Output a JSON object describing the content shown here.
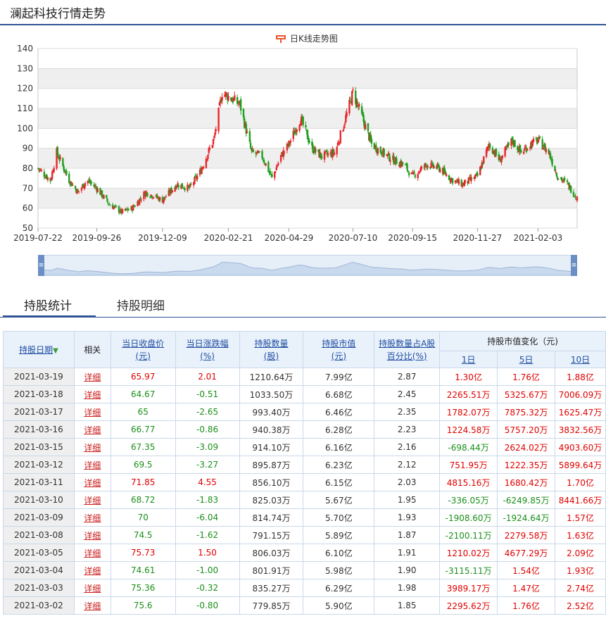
{
  "page_title": "澜起科技行情走势",
  "chart_data": {
    "type": "candlestick",
    "legend": "日K线走势图",
    "ylim": [
      50,
      140
    ],
    "yticks": [
      50,
      60,
      70,
      80,
      90,
      100,
      110,
      120,
      130,
      140
    ],
    "xtick_labels": [
      "2019-07-22",
      "2019-09-26",
      "2019-12-09",
      "2020-02-21",
      "2020-04-29",
      "2020-07-10",
      "2020-09-15",
      "2020-11-27",
      "2021-02-03"
    ],
    "close_path": [
      [
        "2019-07-22",
        80
      ],
      [
        "2019-08-05",
        74
      ],
      [
        "2019-08-12",
        88
      ],
      [
        "2019-08-26",
        74
      ],
      [
        "2019-09-05",
        68
      ],
      [
        "2019-09-15",
        74
      ],
      [
        "2019-09-26",
        70
      ],
      [
        "2019-10-10",
        62
      ],
      [
        "2019-10-24",
        58
      ],
      [
        "2019-11-05",
        60
      ],
      [
        "2019-11-20",
        68
      ],
      [
        "2019-12-09",
        64
      ],
      [
        "2019-12-25",
        72
      ],
      [
        "2020-01-08",
        70
      ],
      [
        "2020-01-20",
        78
      ],
      [
        "2020-02-05",
        95
      ],
      [
        "2020-02-14",
        118
      ],
      [
        "2020-02-21",
        116
      ],
      [
        "2020-03-05",
        112
      ],
      [
        "2020-03-18",
        88
      ],
      [
        "2020-03-30",
        86
      ],
      [
        "2020-04-10",
        75
      ],
      [
        "2020-04-20",
        86
      ],
      [
        "2020-04-29",
        92
      ],
      [
        "2020-05-12",
        105
      ],
      [
        "2020-05-25",
        90
      ],
      [
        "2020-06-05",
        86
      ],
      [
        "2020-06-20",
        88
      ],
      [
        "2020-07-01",
        104
      ],
      [
        "2020-07-10",
        118
      ],
      [
        "2020-07-20",
        106
      ],
      [
        "2020-07-31",
        92
      ],
      [
        "2020-08-12",
        88
      ],
      [
        "2020-08-25",
        84
      ],
      [
        "2020-09-05",
        82
      ],
      [
        "2020-09-15",
        76
      ],
      [
        "2020-10-01",
        82
      ],
      [
        "2020-10-15",
        80
      ],
      [
        "2020-10-30",
        74
      ],
      [
        "2020-11-10",
        72
      ],
      [
        "2020-11-27",
        76
      ],
      [
        "2020-12-10",
        92
      ],
      [
        "2020-12-22",
        84
      ],
      [
        "2021-01-05",
        94
      ],
      [
        "2021-01-15",
        88
      ],
      [
        "2021-01-25",
        92
      ],
      [
        "2021-02-03",
        94
      ],
      [
        "2021-02-15",
        88
      ],
      [
        "2021-02-25",
        76
      ],
      [
        "2021-03-08",
        72
      ],
      [
        "2021-03-19",
        65
      ]
    ]
  },
  "tabs": [
    "持股统计",
    "持股明细"
  ],
  "table": {
    "headers": {
      "date": "持股日期",
      "related": "相关",
      "close_price": [
        "当日收盘价",
        "(元)"
      ],
      "change": [
        "当日涨跌幅",
        "(%)"
      ],
      "shares": [
        "持股数量",
        "(股)"
      ],
      "market_value": [
        "持股市值",
        "(元)"
      ],
      "ratio": [
        "持股数量占A股",
        "百分比(%)"
      ],
      "mv_change": "持股市值变化（元)",
      "mv_change_sub": [
        "1日",
        "5日",
        "10日"
      ]
    },
    "rows": [
      {
        "date": "2021-03-19",
        "link": "详细",
        "close": "65.97",
        "chg": "2.01",
        "shares": "1210.64万",
        "mv": "7.99亿",
        "ratio": "2.87",
        "d1": "1.30亿",
        "d5": "1.76亿",
        "d10": "1.88亿",
        "close_c": "red",
        "chg_c": "red",
        "d1_c": "red",
        "d5_c": "red",
        "d10_c": "red"
      },
      {
        "date": "2021-03-18",
        "link": "详细",
        "close": "64.67",
        "chg": "-0.51",
        "shares": "1033.50万",
        "mv": "6.68亿",
        "ratio": "2.45",
        "d1": "2265.51万",
        "d5": "5325.67万",
        "d10": "7006.09万",
        "close_c": "green",
        "chg_c": "green",
        "d1_c": "red",
        "d5_c": "red",
        "d10_c": "red"
      },
      {
        "date": "2021-03-17",
        "link": "详细",
        "close": "65",
        "chg": "-2.65",
        "shares": "993.40万",
        "mv": "6.46亿",
        "ratio": "2.35",
        "d1": "1782.07万",
        "d5": "7875.32万",
        "d10": "1625.47万",
        "close_c": "green",
        "chg_c": "green",
        "d1_c": "red",
        "d5_c": "red",
        "d10_c": "red"
      },
      {
        "date": "2021-03-16",
        "link": "详细",
        "close": "66.77",
        "chg": "-0.86",
        "shares": "940.38万",
        "mv": "6.28亿",
        "ratio": "2.23",
        "d1": "1224.58万",
        "d5": "5757.20万",
        "d10": "3832.56万",
        "close_c": "green",
        "chg_c": "green",
        "d1_c": "red",
        "d5_c": "red",
        "d10_c": "red"
      },
      {
        "date": "2021-03-15",
        "link": "详细",
        "close": "67.35",
        "chg": "-3.09",
        "shares": "914.10万",
        "mv": "6.16亿",
        "ratio": "2.16",
        "d1": "-698.44万",
        "d5": "2624.02万",
        "d10": "4903.60万",
        "close_c": "green",
        "chg_c": "green",
        "d1_c": "green",
        "d5_c": "red",
        "d10_c": "red"
      },
      {
        "date": "2021-03-12",
        "link": "详细",
        "close": "69.5",
        "chg": "-3.27",
        "shares": "895.87万",
        "mv": "6.23亿",
        "ratio": "2.12",
        "d1": "751.95万",
        "d5": "1222.35万",
        "d10": "5899.64万",
        "close_c": "green",
        "chg_c": "green",
        "d1_c": "red",
        "d5_c": "red",
        "d10_c": "red"
      },
      {
        "date": "2021-03-11",
        "link": "详细",
        "close": "71.85",
        "chg": "4.55",
        "shares": "856.10万",
        "mv": "6.15亿",
        "ratio": "2.03",
        "d1": "4815.16万",
        "d5": "1680.42万",
        "d10": "1.70亿",
        "close_c": "red",
        "chg_c": "red",
        "d1_c": "red",
        "d5_c": "red",
        "d10_c": "red"
      },
      {
        "date": "2021-03-10",
        "link": "详细",
        "close": "68.72",
        "chg": "-1.83",
        "shares": "825.03万",
        "mv": "5.67亿",
        "ratio": "1.95",
        "d1": "-336.05万",
        "d5": "-6249.85万",
        "d10": "8441.66万",
        "close_c": "green",
        "chg_c": "green",
        "d1_c": "green",
        "d5_c": "green",
        "d10_c": "red"
      },
      {
        "date": "2021-03-09",
        "link": "详细",
        "close": "70",
        "chg": "-6.04",
        "shares": "814.74万",
        "mv": "5.70亿",
        "ratio": "1.93",
        "d1": "-1908.60万",
        "d5": "-1924.64万",
        "d10": "1.57亿",
        "close_c": "green",
        "chg_c": "green",
        "d1_c": "green",
        "d5_c": "green",
        "d10_c": "red"
      },
      {
        "date": "2021-03-08",
        "link": "详细",
        "close": "74.5",
        "chg": "-1.62",
        "shares": "791.15万",
        "mv": "5.89亿",
        "ratio": "1.87",
        "d1": "-2100.11万",
        "d5": "2279.58万",
        "d10": "1.63亿",
        "close_c": "green",
        "chg_c": "green",
        "d1_c": "green",
        "d5_c": "red",
        "d10_c": "red"
      },
      {
        "date": "2021-03-05",
        "link": "详细",
        "close": "75.73",
        "chg": "1.50",
        "shares": "806.03万",
        "mv": "6.10亿",
        "ratio": "1.91",
        "d1": "1210.02万",
        "d5": "4677.29万",
        "d10": "2.09亿",
        "close_c": "red",
        "chg_c": "red",
        "d1_c": "red",
        "d5_c": "red",
        "d10_c": "red"
      },
      {
        "date": "2021-03-04",
        "link": "详细",
        "close": "74.61",
        "chg": "-1.00",
        "shares": "801.91万",
        "mv": "5.98亿",
        "ratio": "1.90",
        "d1": "-3115.11万",
        "d5": "1.54亿",
        "d10": "1.93亿",
        "close_c": "green",
        "chg_c": "green",
        "d1_c": "green",
        "d5_c": "red",
        "d10_c": "red"
      },
      {
        "date": "2021-03-03",
        "link": "详细",
        "close": "75.36",
        "chg": "-0.32",
        "shares": "835.27万",
        "mv": "6.29亿",
        "ratio": "1.98",
        "d1": "3989.17万",
        "d5": "1.47亿",
        "d10": "2.74亿",
        "close_c": "green",
        "chg_c": "green",
        "d1_c": "red",
        "d5_c": "red",
        "d10_c": "red"
      },
      {
        "date": "2021-03-02",
        "link": "详细",
        "close": "75.6",
        "chg": "-0.80",
        "shares": "779.85万",
        "mv": "5.90亿",
        "ratio": "1.85",
        "d1": "2295.62万",
        "d5": "1.76亿",
        "d10": "2.52亿",
        "close_c": "green",
        "chg_c": "green",
        "d1_c": "red",
        "d5_c": "red",
        "d10_c": "red"
      }
    ]
  },
  "colors": {
    "up": "#e8262b",
    "down": "#1f9f1f",
    "accent": "#2f5496"
  }
}
